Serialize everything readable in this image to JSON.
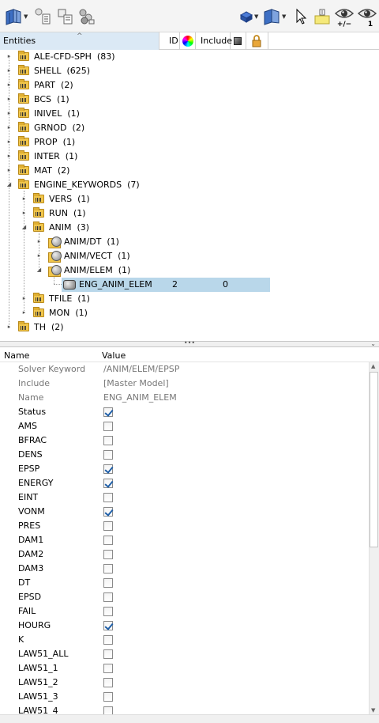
{
  "toolbar": {
    "left_icons": [
      "entity-view-icon",
      "filter-icon",
      "tree-options-icon",
      "library-icon"
    ],
    "right_icons": [
      "component-icon",
      "model-view-icon",
      "select-arrow-icon",
      "highlight-icon",
      "show-hide-eye-icon",
      "isolate-eye-icon"
    ],
    "show_hide_label": "+/−",
    "isolate_label": "1"
  },
  "tree_header": {
    "entities": "Entities",
    "id": "ID",
    "include": "Include"
  },
  "tree": {
    "rows": [
      {
        "label": "ALE-CFD-SPH",
        "count": "(83)"
      },
      {
        "label": "SHELL",
        "count": "(625)"
      },
      {
        "label": "PART",
        "count": "(2)"
      },
      {
        "label": "BCS",
        "count": "(1)"
      },
      {
        "label": "INIVEL",
        "count": "(1)"
      },
      {
        "label": "GRNOD",
        "count": "(2)"
      },
      {
        "label": "PROP",
        "count": "(1)"
      },
      {
        "label": "INTER",
        "count": "(1)"
      },
      {
        "label": "MAT",
        "count": "(2)"
      },
      {
        "label": "ENGINE_KEYWORDS",
        "count": "(7)"
      },
      {
        "label": "VERS",
        "count": "(1)"
      },
      {
        "label": "RUN",
        "count": "(1)"
      },
      {
        "label": "ANIM",
        "count": "(3)"
      },
      {
        "label": "ANIM/DT",
        "count": "(1)"
      },
      {
        "label": "ANIM/VECT",
        "count": "(1)"
      },
      {
        "label": "ANIM/ELEM",
        "count": "(1)"
      },
      {
        "label": "ENG_ANIM_ELEM",
        "id": "2",
        "include": "0"
      },
      {
        "label": "TFILE",
        "count": "(1)"
      },
      {
        "label": "MON",
        "count": "(1)"
      },
      {
        "label": "TH",
        "count": "(2)"
      }
    ]
  },
  "splitter": "•••",
  "props_header": {
    "name": "Name",
    "value": "Value"
  },
  "properties": [
    {
      "name": "Solver Keyword",
      "value": "/ANIM/ELEM/EPSP"
    },
    {
      "name": "Include",
      "value": "[Master Model]"
    },
    {
      "name": "Name",
      "value": "ENG_ANIM_ELEM"
    },
    {
      "name": "Status",
      "checked": true
    },
    {
      "name": "AMS",
      "checked": false
    },
    {
      "name": "BFRAC",
      "checked": false
    },
    {
      "name": "DENS",
      "checked": false
    },
    {
      "name": "EPSP",
      "checked": true
    },
    {
      "name": "ENERGY",
      "checked": true
    },
    {
      "name": "EINT",
      "checked": false
    },
    {
      "name": "VONM",
      "checked": true
    },
    {
      "name": "PRES",
      "checked": false
    },
    {
      "name": "DAM1",
      "checked": false
    },
    {
      "name": "DAM2",
      "checked": false
    },
    {
      "name": "DAM3",
      "checked": false
    },
    {
      "name": "DT",
      "checked": false
    },
    {
      "name": "EPSD",
      "checked": false
    },
    {
      "name": "FAIL",
      "checked": false
    },
    {
      "name": "HOURG",
      "checked": true
    },
    {
      "name": "K",
      "checked": false
    },
    {
      "name": "LAW51_ALL",
      "checked": false
    },
    {
      "name": "LAW51_1",
      "checked": false
    },
    {
      "name": "LAW51_2",
      "checked": false
    },
    {
      "name": "LAW51_3",
      "checked": false
    },
    {
      "name": "LAW51_4",
      "checked": false
    }
  ]
}
